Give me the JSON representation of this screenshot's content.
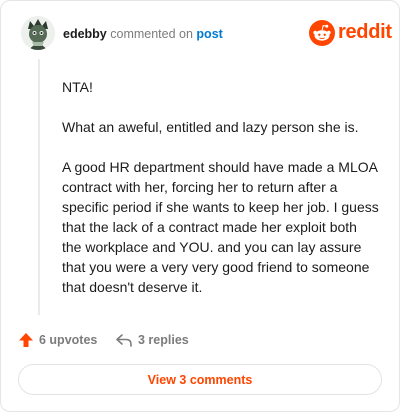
{
  "comment": {
    "username": "edebby",
    "action_text": "commented on",
    "post_link": "post",
    "paragraphs": [
      "NTA!",
      "What an aweful, entitled and lazy person she is.",
      "A good HR department should have made a MLOA contract with her, forcing her to return after a specific period if she wants to keep her job. I guess that the lack of a contract made her exploit both the workplace and YOU. and you can lay assure that you were a very very good friend to someone that doesn't deserve it."
    ],
    "upvotes_label": "6 upvotes",
    "replies_label": "3 replies"
  },
  "brand": {
    "wordmark": "reddit",
    "color": "#ff4500"
  },
  "view_comments_label": "View 3 comments",
  "colors": {
    "accent": "#ff4500",
    "link": "#0079d3",
    "muted": "#7c7c7c"
  },
  "icons": [
    "user-avatar",
    "reddit-snoo-icon",
    "upvote-arrow-icon",
    "reply-arrow-icon"
  ]
}
